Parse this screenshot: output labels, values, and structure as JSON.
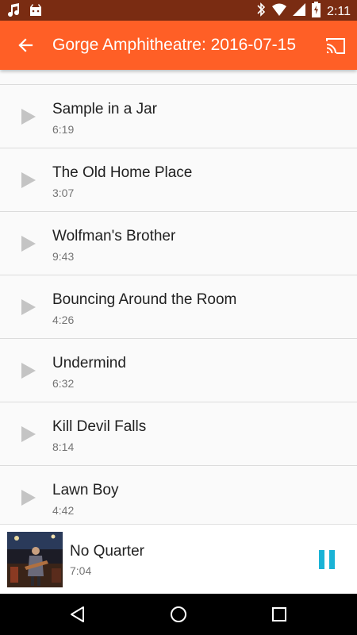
{
  "status_bar": {
    "time": "2:11",
    "icons": [
      "music-note-icon",
      "android-icon",
      "bluetooth-icon",
      "wifi-icon",
      "signal-icon",
      "battery-charging-icon"
    ]
  },
  "app_bar": {
    "title": "Gorge Amphitheatre: 2016-07-15",
    "back_icon": "arrow-back-icon",
    "cast_icon": "cast-icon",
    "color": "#ff5f26"
  },
  "tracks": [
    {
      "title": "Sample in a Jar",
      "duration": "6:19"
    },
    {
      "title": "The Old Home Place",
      "duration": "3:07"
    },
    {
      "title": "Wolfman's Brother",
      "duration": "9:43"
    },
    {
      "title": "Bouncing Around the Room",
      "duration": "4:26"
    },
    {
      "title": "Undermind",
      "duration": "6:32"
    },
    {
      "title": "Kill Devil Falls",
      "duration": "8:14"
    },
    {
      "title": "Lawn Boy",
      "duration": "4:42"
    }
  ],
  "now_playing": {
    "title": "No Quarter",
    "duration": "7:04",
    "pause_icon": "pause-icon",
    "accent": "#1ab3d6"
  },
  "nav_bar": {
    "icons": [
      "back-triangle-icon",
      "home-circle-icon",
      "recents-square-icon"
    ]
  }
}
